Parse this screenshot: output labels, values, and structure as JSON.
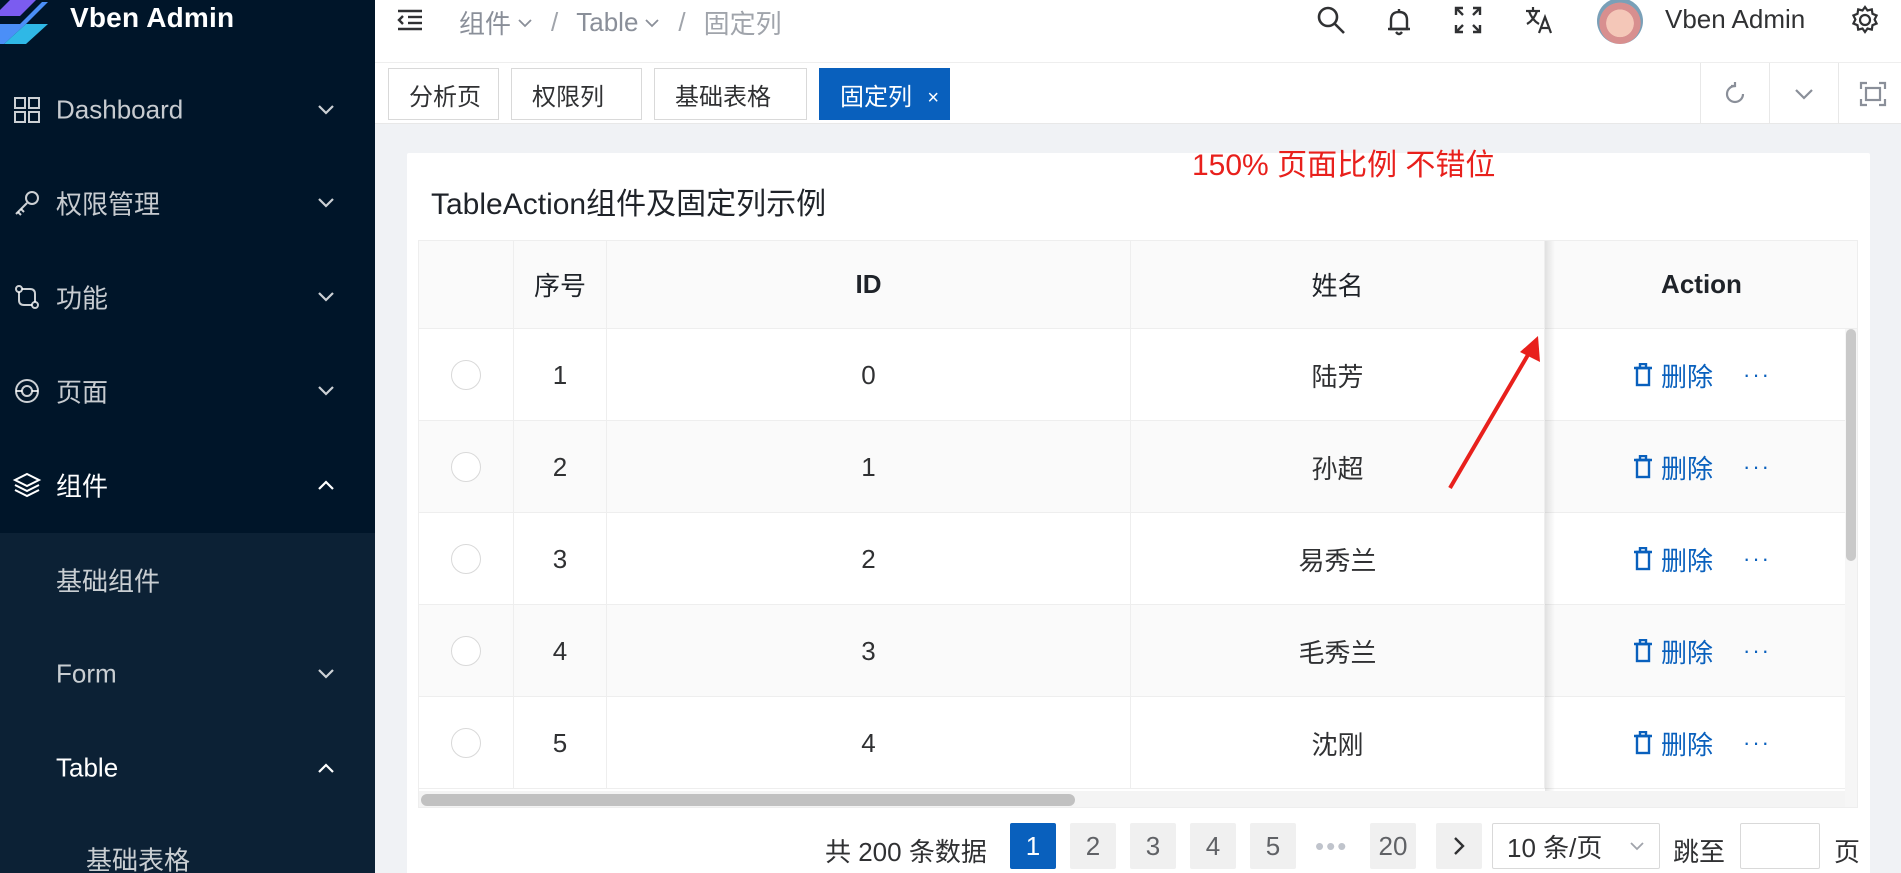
{
  "app": {
    "title": "Vben Admin"
  },
  "sidebar": {
    "items": [
      {
        "label": "Dashboard",
        "icon": "dashboard-icon",
        "expanded": false
      },
      {
        "label": "权限管理",
        "icon": "key-icon",
        "expanded": false
      },
      {
        "label": "功能",
        "icon": "function-icon",
        "expanded": false
      },
      {
        "label": "页面",
        "icon": "page-icon",
        "expanded": false
      },
      {
        "label": "组件",
        "icon": "layers-icon",
        "expanded": true
      }
    ],
    "sub_items": [
      {
        "label": "基础组件"
      },
      {
        "label": "Form",
        "expanded": false
      },
      {
        "label": "Table",
        "expanded": true
      }
    ],
    "sub_sub_items": [
      {
        "label": "基础表格"
      }
    ]
  },
  "header": {
    "breadcrumb": [
      {
        "label": "组件",
        "has_caret": true
      },
      {
        "label": "Table",
        "has_caret": true
      },
      {
        "label": "固定列",
        "has_caret": false
      }
    ],
    "user_name": "Vben Admin"
  },
  "tabs": [
    {
      "label": "分析页",
      "active": false
    },
    {
      "label": "权限列",
      "active": false
    },
    {
      "label": "基础表格",
      "active": false
    },
    {
      "label": "固定列",
      "active": true,
      "close": "×"
    }
  ],
  "main": {
    "card_title": "TableAction组件及固定列示例",
    "annotation": "150%  页面比例 不错位"
  },
  "table": {
    "columns": {
      "index": "序号",
      "id": "ID",
      "name": "姓名",
      "action": "Action"
    },
    "rows": [
      {
        "index": "1",
        "id": "0",
        "name": "陆芳"
      },
      {
        "index": "2",
        "id": "1",
        "name": "孙超"
      },
      {
        "index": "3",
        "id": "2",
        "name": "易秀兰"
      },
      {
        "index": "4",
        "id": "3",
        "name": "毛秀兰"
      },
      {
        "index": "5",
        "id": "4",
        "name": "沈刚"
      }
    ],
    "action_delete_label": "删除",
    "action_more_label": "···"
  },
  "pagination": {
    "total_text": "共 200 条数据",
    "pages": [
      "1",
      "2",
      "3",
      "4",
      "5"
    ],
    "ellipsis": "•••",
    "last_page": "20",
    "current": "1",
    "page_size": "10 条/页",
    "jump_label": "跳至",
    "page_label": "页"
  },
  "colors": {
    "primary": "#0960bd",
    "sidebar_bg": "#001529",
    "annotation": "#e8201c"
  }
}
